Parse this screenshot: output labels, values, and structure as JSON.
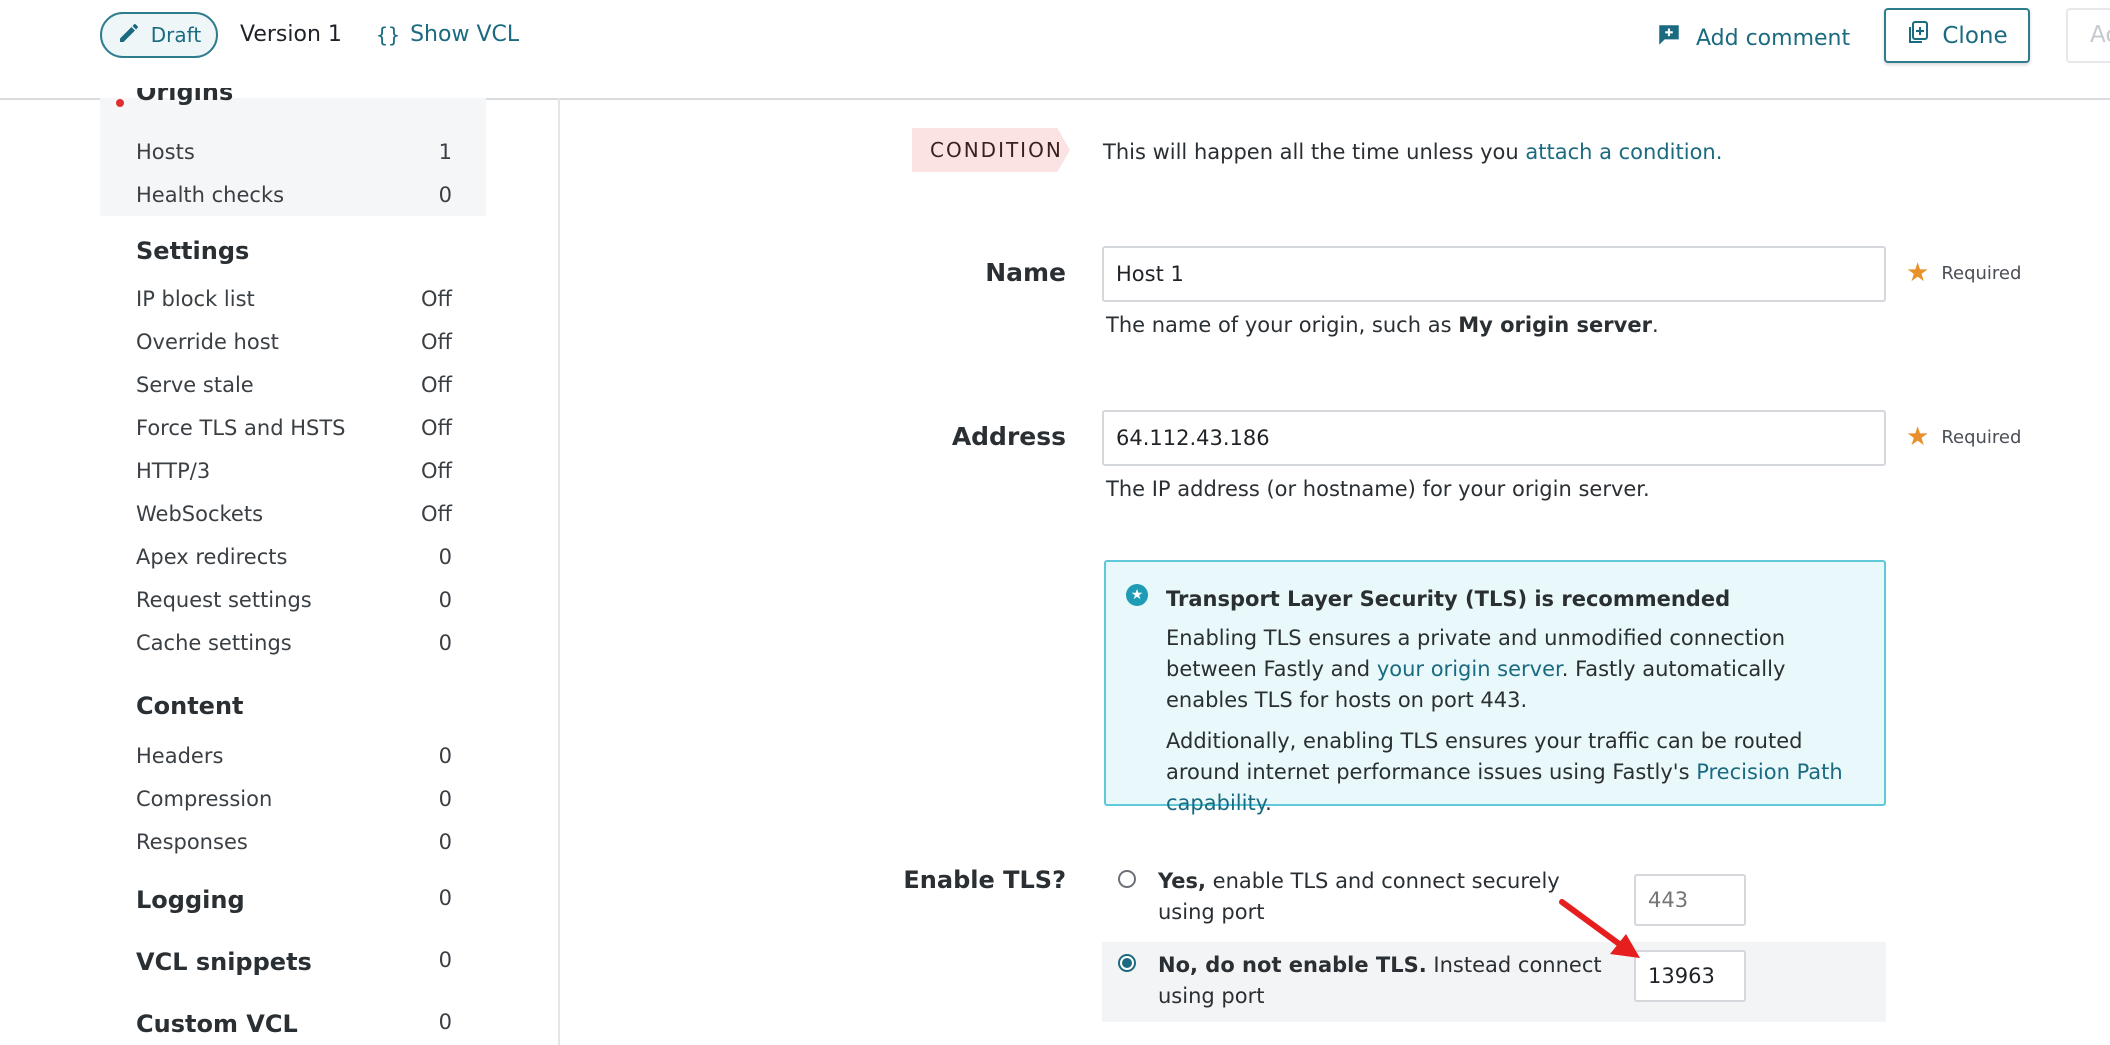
{
  "header": {
    "draft_label": "Draft",
    "version_label": "Version 1",
    "show_vcl_label": "Show VCL",
    "add_comment_label": "Add comment",
    "clone_label": "Clone",
    "activate_label_partial": "Ac"
  },
  "sidebar": {
    "origins": {
      "title": "Origins",
      "items": [
        {
          "label": "Hosts",
          "count": "1"
        },
        {
          "label": "Health checks",
          "count": "0"
        }
      ]
    },
    "settings": {
      "title": "Settings",
      "items": [
        {
          "label": "IP block list",
          "count": "Off"
        },
        {
          "label": "Override host",
          "count": "Off"
        },
        {
          "label": "Serve stale",
          "count": "Off"
        },
        {
          "label": "Force TLS and HSTS",
          "count": "Off"
        },
        {
          "label": "HTTP/3",
          "count": "Off"
        },
        {
          "label": "WebSockets",
          "count": "Off"
        },
        {
          "label": "Apex redirects",
          "count": "0"
        },
        {
          "label": "Request settings",
          "count": "0"
        },
        {
          "label": "Cache settings",
          "count": "0"
        }
      ]
    },
    "content": {
      "title": "Content",
      "items": [
        {
          "label": "Headers",
          "count": "0"
        },
        {
          "label": "Compression",
          "count": "0"
        },
        {
          "label": "Responses",
          "count": "0"
        }
      ]
    },
    "logging": {
      "title": "Logging",
      "count": "0"
    },
    "vcl_snippets": {
      "title": "VCL snippets",
      "count": "0"
    },
    "custom_vcl": {
      "title": "Custom VCL",
      "count": "0"
    }
  },
  "main": {
    "condition": {
      "badge": "CONDITION",
      "text_prefix": "This will happen all the time unless you ",
      "link": "attach a condition."
    },
    "name_field": {
      "label": "Name",
      "value": "Host 1",
      "required": "Required",
      "help_prefix": "The name of your origin, such as ",
      "help_bold": "My origin server",
      "help_suffix": "."
    },
    "address_field": {
      "label": "Address",
      "value": "64.112.43.186",
      "required": "Required",
      "help": "The IP address (or hostname) for your origin server."
    },
    "tls_info": {
      "title": "Transport Layer Security (TLS) is recommended",
      "p1_a": "Enabling TLS ensures a private and unmodified connection between Fastly and ",
      "p1_link": "your origin server",
      "p1_b": ". Fastly automatically enables TLS for hosts on port 443.",
      "p2_a": "Additionally, enabling TLS ensures your traffic can be routed around internet performance issues using Fastly's ",
      "p2_link": "Precision Path capability",
      "p2_b": "."
    },
    "enable_tls": {
      "label": "Enable TLS?",
      "yes_bold": "Yes,",
      "yes_text": " enable TLS and connect securely using port",
      "yes_port_placeholder": "443",
      "no_bold": "No, do not enable TLS.",
      "no_text": " Instead connect using port",
      "no_port_value": "13963",
      "selected": "no"
    },
    "annotation_arrow_color": "#e61e1e"
  }
}
